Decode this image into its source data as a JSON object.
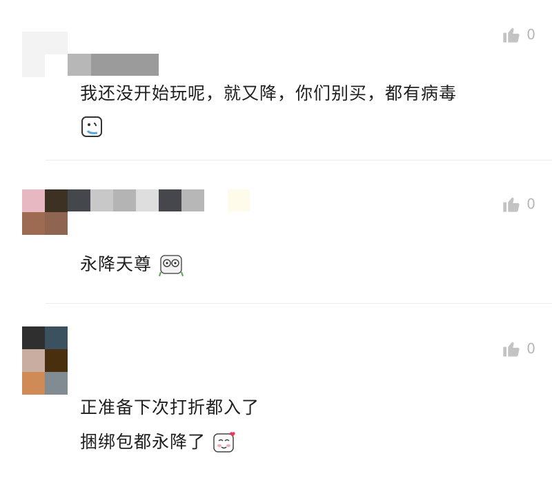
{
  "comments": [
    {
      "text_lines": [
        "我还没开始玩呢，就又降，你们别买，都有病毒"
      ],
      "emoji": "crying-face-emoji",
      "likes": "0",
      "avatar_colors": [
        "#f4f4f4",
        "#f4f4f4",
        "#f4f4f4",
        "#ffffff"
      ],
      "name_colors": [
        "#b5b5b5",
        "#9a9a9a",
        "#9a9a9a"
      ]
    },
    {
      "text_lines": [
        "永降天尊"
      ],
      "emoji": "shocked-panda-emoji",
      "likes": "0",
      "avatar_colors": [
        "#e7b7c2",
        "#3f3227",
        "#9e6a52",
        "#8e6350"
      ],
      "name_colors": [
        "#3f3227",
        "#41454b",
        "#c9c9c9",
        "#b6b6b6",
        "#dddddd",
        "#45454d",
        "#b4b4b4"
      ]
    },
    {
      "text_lines": [
        "正准备下次打折都入了",
        "捆绑包都永降了"
      ],
      "emoji": "blushing-face-emoji",
      "likes": "0",
      "avatar_colors": [
        "#2f2f2f",
        "#3c5160",
        "#c8ada0",
        "#4a2f0e",
        "#d08a55",
        "#818b92"
      ],
      "name_colors": []
    }
  ],
  "ui": {
    "like_icon": "thumbs-up-icon"
  }
}
